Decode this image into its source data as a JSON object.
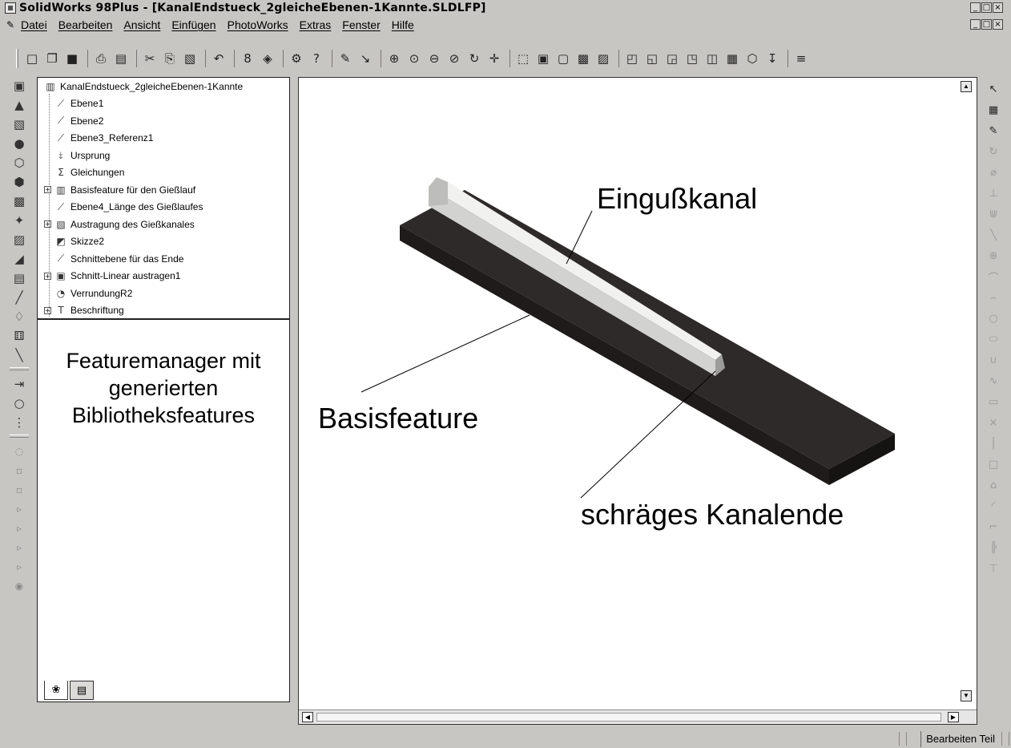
{
  "window": {
    "title": "SolidWorks 98Plus - [KanalEndstueck_2gleicheEbenen-1Kannte.SLDLFP]",
    "controls": [
      "_",
      "□",
      "×"
    ]
  },
  "menu": {
    "items": [
      "Datei",
      "Bearbeiten",
      "Ansicht",
      "Einfügen",
      "PhotoWorks",
      "Extras",
      "Fenster",
      "Hilfe"
    ]
  },
  "toolbar": {
    "icons": [
      {
        "name": "new-icon",
        "glyph": "□"
      },
      {
        "name": "open-icon",
        "glyph": "❐"
      },
      {
        "name": "save-icon",
        "glyph": "■"
      },
      {
        "name": "print-icon",
        "glyph": "⎙"
      },
      {
        "name": "print-preview-icon",
        "glyph": "▤"
      },
      {
        "name": "cut-icon",
        "glyph": "✂"
      },
      {
        "name": "copy-icon",
        "glyph": "⎘"
      },
      {
        "name": "paste-icon",
        "glyph": "▧"
      },
      {
        "name": "undo-icon",
        "glyph": "↶"
      },
      {
        "name": "rebuild-icon",
        "glyph": "8"
      },
      {
        "name": "edit-color-icon",
        "glyph": "◈"
      },
      {
        "name": "options-icon",
        "glyph": "⚙"
      },
      {
        "name": "whats-this-icon",
        "glyph": "?"
      },
      {
        "name": "sketch-icon",
        "glyph": "✎"
      },
      {
        "name": "smart-dimension-icon",
        "glyph": "↘"
      },
      {
        "name": "zoom-fit-icon",
        "glyph": "⊕"
      },
      {
        "name": "zoom-area-icon",
        "glyph": "⊙"
      },
      {
        "name": "zoom-in-out-icon",
        "glyph": "⊖"
      },
      {
        "name": "zoom-selection-icon",
        "glyph": "⊘"
      },
      {
        "name": "rotate-icon",
        "glyph": "↻"
      },
      {
        "name": "pan-icon",
        "glyph": "✛"
      },
      {
        "name": "wireframe-icon",
        "glyph": "⬚"
      },
      {
        "name": "hidden-lines-gray-icon",
        "glyph": "▣"
      },
      {
        "name": "hidden-lines-removed-icon",
        "glyph": "▢"
      },
      {
        "name": "shaded-icon",
        "glyph": "▩"
      },
      {
        "name": "perspective-icon",
        "glyph": "▨"
      },
      {
        "name": "view-front-icon",
        "glyph": "◰"
      },
      {
        "name": "view-back-icon",
        "glyph": "◱"
      },
      {
        "name": "view-left-icon",
        "glyph": "◲"
      },
      {
        "name": "view-right-icon",
        "glyph": "◳"
      },
      {
        "name": "view-top-icon",
        "glyph": "◫"
      },
      {
        "name": "view-bottom-icon",
        "glyph": "▦"
      },
      {
        "name": "view-isometric-icon",
        "glyph": "⬡"
      },
      {
        "name": "normal-to-icon",
        "glyph": "↧"
      },
      {
        "name": "dim-tool-icon",
        "glyph": "≡"
      }
    ]
  },
  "left_toolbar": {
    "icons": [
      {
        "name": "extrude-boss-icon",
        "glyph": "▣"
      },
      {
        "name": "revolve-boss-icon",
        "glyph": "▲"
      },
      {
        "name": "sweep-boss-icon",
        "glyph": "▧"
      },
      {
        "name": "loft-boss-icon",
        "glyph": "●"
      },
      {
        "name": "extrude-cut-icon",
        "glyph": "⬡"
      },
      {
        "name": "revolve-cut-icon",
        "glyph": "⬢"
      },
      {
        "name": "sweep-cut-icon",
        "glyph": "▩"
      },
      {
        "name": "loft-cut-icon",
        "glyph": "✦"
      },
      {
        "name": "fillet-icon",
        "glyph": "▨"
      },
      {
        "name": "chamfer-icon",
        "glyph": "◢"
      },
      {
        "name": "shell-icon",
        "glyph": "▤"
      },
      {
        "name": "draft-icon",
        "glyph": "╱"
      },
      {
        "name": "rib-icon",
        "glyph": "♢"
      },
      {
        "name": "mirror-icon",
        "glyph": "⚅"
      },
      {
        "name": "line-icon",
        "glyph": "╲"
      },
      {
        "name": "trim-icon",
        "glyph": "⇥"
      },
      {
        "name": "circle-tool-icon",
        "glyph": "○"
      },
      {
        "name": "linear-pattern-icon",
        "glyph": "⋮"
      },
      {
        "name": "circular-pattern-icon",
        "glyph": "◌"
      },
      {
        "name": "pattern-icon-1",
        "glyph": "▫"
      },
      {
        "name": "pattern-icon-2",
        "glyph": "▫"
      },
      {
        "name": "pattern-icon-3",
        "glyph": "▹"
      },
      {
        "name": "pattern-icon-4",
        "glyph": "▹"
      },
      {
        "name": "pattern-icon-5",
        "glyph": "▹"
      },
      {
        "name": "pattern-icon-6",
        "glyph": "▹"
      },
      {
        "name": "record-icon",
        "glyph": "◉"
      }
    ]
  },
  "feature_tree": {
    "root": "KanalEndstueck_2gleicheEbenen-1Kannte",
    "items": [
      {
        "label": "Ebene1",
        "icon": "plane-icon",
        "glyph": "⟋",
        "expandable": false
      },
      {
        "label": "Ebene2",
        "icon": "plane-icon",
        "glyph": "⟋",
        "expandable": false
      },
      {
        "label": "Ebene3_Referenz1",
        "icon": "plane-icon",
        "glyph": "⟋",
        "expandable": false
      },
      {
        "label": "Ursprung",
        "icon": "origin-icon",
        "glyph": "⤈",
        "expandable": false
      },
      {
        "label": "Gleichungen",
        "icon": "equations-icon",
        "glyph": "Σ",
        "expandable": false
      },
      {
        "label": "Basisfeature für den Gießlauf",
        "icon": "base-feature-icon",
        "glyph": "▥",
        "expandable": true
      },
      {
        "label": "Ebene4_Länge des Gießlaufes",
        "icon": "plane-icon",
        "glyph": "⟋",
        "expandable": false
      },
      {
        "label": "Austragung des Gießkanales",
        "icon": "extrude-icon",
        "glyph": "▧",
        "expandable": true
      },
      {
        "label": "Skizze2",
        "icon": "sketch-icon",
        "glyph": "◩",
        "expandable": false
      },
      {
        "label": "Schnittebene für das Ende",
        "icon": "plane-icon",
        "glyph": "⟋",
        "expandable": false
      },
      {
        "label": "Schnitt-Linear austragen1",
        "icon": "cut-extrude-icon",
        "glyph": "▣",
        "expandable": true
      },
      {
        "label": "VerrundungR2",
        "icon": "fillet-icon",
        "glyph": "◔",
        "expandable": false
      },
      {
        "label": "Beschriftung",
        "icon": "annotation-icon",
        "glyph": "T",
        "expandable": true
      }
    ],
    "caption": "Featuremanager mit generierten Bibliotheksfeatures",
    "tabs": [
      {
        "name": "featuremanager-tab",
        "glyph": "❀"
      },
      {
        "name": "propertymanager-tab",
        "glyph": "▤"
      }
    ]
  },
  "graphics": {
    "annotations": {
      "eingusskanal": "Eingußkanal",
      "basisfeature": "Basisfeature",
      "kanalende": "schräges Kanalende"
    },
    "colors": {
      "base_dark": "#2b2827",
      "channel_light": "#e8e8e6"
    }
  },
  "right_toolbar": {
    "icons": [
      {
        "name": "select-icon",
        "glyph": "↖",
        "on": true
      },
      {
        "name": "grid-icon",
        "glyph": "▦",
        "on": true
      },
      {
        "name": "sketch-toggle-icon",
        "glyph": "✎",
        "on": true
      },
      {
        "name": "rebuild-sketch-icon",
        "glyph": "↻",
        "on": false
      },
      {
        "name": "dimension-icon",
        "glyph": "⌀",
        "on": false
      },
      {
        "name": "relation-icon",
        "glyph": "⊥",
        "on": false
      },
      {
        "name": "fix-icon",
        "glyph": "⋓",
        "on": false
      },
      {
        "name": "line-draw-icon",
        "glyph": "╲",
        "on": false
      },
      {
        "name": "centerline-icon",
        "glyph": "⊕",
        "on": false
      },
      {
        "name": "arc-icon",
        "glyph": "⌒",
        "on": false
      },
      {
        "name": "tangent-arc-icon",
        "glyph": "⌢",
        "on": false
      },
      {
        "name": "circle-icon",
        "glyph": "○",
        "on": false
      },
      {
        "name": "ellipse-icon",
        "glyph": "⬭",
        "on": false
      },
      {
        "name": "parabola-icon",
        "glyph": "∪",
        "on": false
      },
      {
        "name": "spline-icon",
        "glyph": "∿",
        "on": false
      },
      {
        "name": "rectangle-icon",
        "glyph": "▭",
        "on": false
      },
      {
        "name": "point-icon",
        "glyph": "×",
        "on": false
      },
      {
        "name": "construction-icon",
        "glyph": "│",
        "on": false
      },
      {
        "name": "offset-icon",
        "glyph": "□",
        "on": false
      },
      {
        "name": "convert-icon",
        "glyph": "⌂",
        "on": false
      },
      {
        "name": "fillet-sketch-icon",
        "glyph": "◜",
        "on": false
      },
      {
        "name": "trim-sketch-icon",
        "glyph": "⌐",
        "on": false
      },
      {
        "name": "extend-icon",
        "glyph": "╠",
        "on": false
      },
      {
        "name": "split-icon",
        "glyph": "⊤",
        "on": false
      }
    ]
  },
  "status": {
    "mode": "Bearbeiten Teil"
  }
}
